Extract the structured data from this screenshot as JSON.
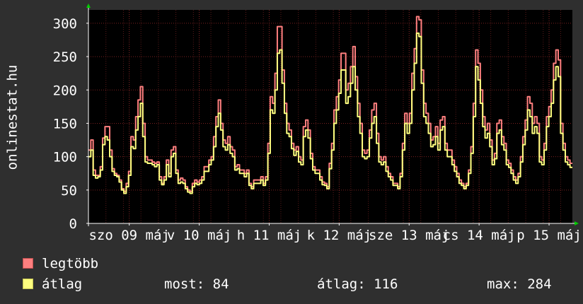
{
  "chart_data": {
    "type": "line",
    "ylabel": "onlinestat.hu",
    "ylim": [
      0,
      320
    ],
    "yticks": [
      0,
      50,
      100,
      150,
      200,
      250,
      300
    ],
    "x_tick_labels": [
      "szo 09 máj",
      "v 10 máj",
      "h 11 máj",
      "k 12 máj",
      "sze 13 máj",
      "cs 14 máj",
      "p 15 máj"
    ],
    "x_tick_hours": [
      14,
      38,
      62,
      86,
      110,
      134,
      158
    ],
    "hours_total": 166,
    "series": [
      {
        "name": "legtöbb",
        "color": "#ff7f7f",
        "values": [
          110,
          125,
          80,
          72,
          72,
          85,
          128,
          145,
          145,
          110,
          82,
          75,
          72,
          65,
          52,
          48,
          60,
          78,
          130,
          125,
          160,
          185,
          205,
          150,
          100,
          95,
          95,
          92,
          90,
          92,
          70,
          60,
          70,
          95,
          75,
          110,
          115,
          80,
          65,
          68,
          65,
          55,
          50,
          48,
          60,
          65,
          62,
          65,
          70,
          85,
          85,
          95,
          100,
          130,
          160,
          185,
          150,
          125,
          120,
          130,
          115,
          110,
          85,
          88,
          80,
          80,
          75,
          80,
          60,
          55,
          65,
          65,
          65,
          70,
          60,
          70,
          120,
          190,
          180,
          225,
          295,
          295,
          230,
          180,
          150,
          140,
          120,
          110,
          115,
          100,
          95,
          145,
          155,
          140,
          105,
          85,
          80,
          80,
          70,
          62,
          60,
          55,
          90,
          120,
          170,
          190,
          215,
          255,
          255,
          200,
          210,
          235,
          265,
          220,
          180,
          150,
          110,
          105,
          110,
          140,
          170,
          180,
          135,
          100,
          95,
          100,
          85,
          75,
          70,
          60,
          60,
          55,
          75,
          120,
          165,
          150,
          165,
          225,
          262,
          310,
          305,
          230,
          180,
          165,
          150,
          125,
          130,
          145,
          120,
          155,
          160,
          120,
          110,
          110,
          95,
          85,
          75,
          65,
          60,
          55,
          60,
          80,
          115,
          180,
          260,
          240,
          200,
          160,
          140,
          150,
          125,
          95,
          105,
          150,
          155,
          130,
          120,
          95,
          90,
          80,
          70,
          65,
          75,
          100,
          130,
          155,
          190,
          180,
          150,
          160,
          150,
          100,
          95,
          120,
          160,
          175,
          200,
          240,
          260,
          245,
          150,
          120,
          100,
          95,
          90
        ]
      },
      {
        "name": "átlag",
        "color": "#ffff7f",
        "values": [
          100,
          110,
          72,
          68,
          70,
          80,
          118,
          130,
          125,
          100,
          78,
          72,
          70,
          62,
          50,
          45,
          55,
          72,
          115,
          112,
          140,
          160,
          180,
          130,
          92,
          90,
          90,
          88,
          85,
          88,
          65,
          58,
          65,
          88,
          70,
          100,
          105,
          75,
          60,
          62,
          60,
          52,
          47,
          45,
          55,
          60,
          58,
          60,
          65,
          78,
          78,
          88,
          95,
          115,
          145,
          165,
          140,
          115,
          110,
          118,
          105,
          100,
          80,
          82,
          75,
          75,
          70,
          75,
          57,
          52,
          60,
          60,
          60,
          65,
          57,
          65,
          105,
          170,
          165,
          200,
          255,
          260,
          210,
          165,
          135,
          130,
          112,
          102,
          108,
          92,
          88,
          130,
          140,
          128,
          97,
          80,
          75,
          75,
          65,
          58,
          57,
          52,
          82,
          110,
          150,
          170,
          195,
          230,
          230,
          180,
          190,
          210,
          235,
          200,
          160,
          135,
          100,
          97,
          100,
          128,
          150,
          160,
          120,
          92,
          88,
          92,
          78,
          70,
          65,
          57,
          57,
          52,
          70,
          110,
          150,
          135,
          150,
          200,
          240,
          285,
          280,
          210,
          160,
          150,
          135,
          115,
          118,
          130,
          110,
          140,
          145,
          110,
          100,
          100,
          88,
          78,
          70,
          60,
          57,
          52,
          57,
          75,
          105,
          160,
          235,
          215,
          180,
          145,
          128,
          135,
          115,
          88,
          97,
          135,
          140,
          118,
          110,
          88,
          84,
          75,
          65,
          60,
          70,
          92,
          118,
          140,
          170,
          160,
          135,
          145,
          135,
          92,
          88,
          110,
          145,
          160,
          180,
          215,
          235,
          220,
          135,
          110,
          92,
          88,
          84
        ]
      }
    ],
    "grid": true
  },
  "legend": {
    "items": [
      {
        "label": "legtöbb",
        "color": "#ff7f7f"
      },
      {
        "label": "átlag",
        "color": "#ffff7f"
      }
    ]
  },
  "stats": {
    "most": "most: 84",
    "atlag": "átlag: 116",
    "max": "max: 284"
  }
}
